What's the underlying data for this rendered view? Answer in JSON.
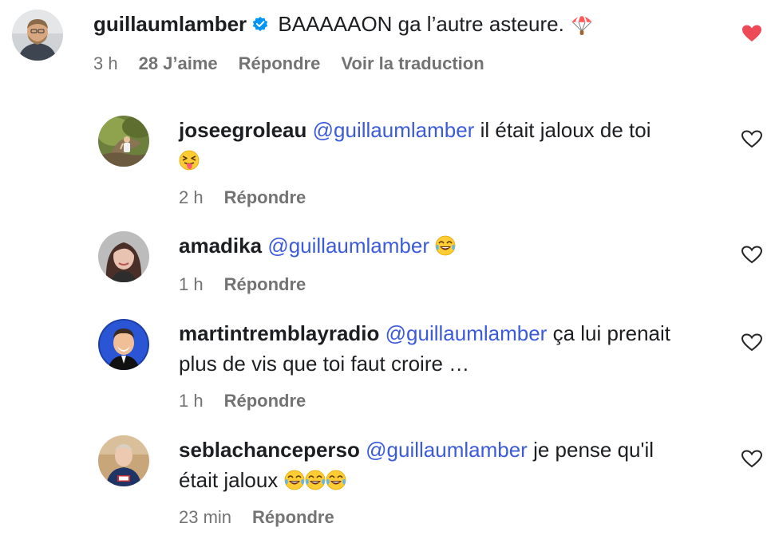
{
  "colors": {
    "mention": "#3b5bdb",
    "meta_text": "#737373",
    "liked_heart": "#ed4956",
    "verified_badge": "#0095f6"
  },
  "main_comment": {
    "username": "guillaumlamber",
    "verified": true,
    "text": "BAAAAAON ga l’autre asteure.",
    "emoji": "parachute-emoji",
    "time": "3 h",
    "likes": "28 J’aime",
    "reply_label": "Répondre",
    "translate_label": "Voir la traduction",
    "liked": true
  },
  "replies": [
    {
      "username": "joseegroleau",
      "mention": "@guillaumlamber",
      "text": "il était jaloux de toi",
      "emojis": [
        "squinting-tongue-emoji"
      ],
      "time": "2 h",
      "reply_label": "Répondre"
    },
    {
      "username": "amadika",
      "mention": "@guillaumlamber",
      "text": "",
      "emojis": [
        "tears-of-joy-emoji"
      ],
      "time": "1 h",
      "reply_label": "Répondre"
    },
    {
      "username": "martintremblayradio",
      "mention": "@guillaumlamber",
      "text_line1": "ça lui prenait",
      "text_line2": "plus de vis que toi faut croire …",
      "time": "1 h",
      "reply_label": "Répondre"
    },
    {
      "username": "seblachanceperso",
      "mention": "@guillaumlamber",
      "text_line1": "je pense qu'il",
      "text_line2": "était jaloux",
      "emojis": [
        "tears-of-joy-emoji",
        "tears-of-joy-emoji",
        "tears-of-joy-emoji"
      ],
      "time": "23 min",
      "reply_label": "Répondre"
    }
  ]
}
